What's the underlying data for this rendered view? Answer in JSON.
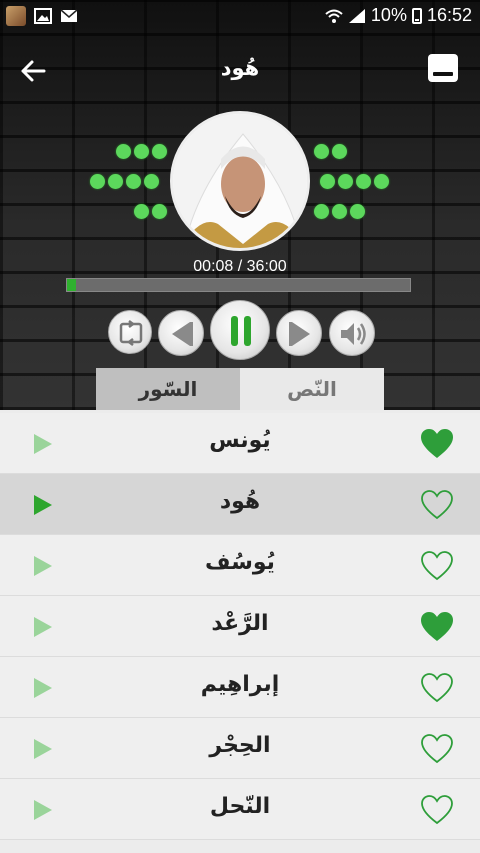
{
  "status_bar": {
    "battery": "10%",
    "time": "16:52",
    "icons": [
      "photo-notification-icon",
      "image-icon",
      "mail-icon",
      "wifi-icon",
      "signal-icon",
      "battery-icon"
    ]
  },
  "toolbar": {
    "title": "هُود",
    "back_icon": "back-arrow-icon",
    "minimize_icon": "minimize-icon"
  },
  "player": {
    "elapsed": "00:08",
    "total": "36:00",
    "time_label": "00:08 / 36:00",
    "progress_fraction": 0.004,
    "controls": [
      "repeat-icon",
      "previous-icon",
      "pause-icon",
      "next-icon",
      "volume-icon"
    ]
  },
  "tabs": {
    "text": "النّص",
    "surahs": "السّور",
    "active": "surahs"
  },
  "colors": {
    "accent_green": "#2fb12f",
    "dot_green": "#5cd85c",
    "heart_green": "#2e9e3a"
  },
  "surahs": [
    {
      "name": "يُونس",
      "favorite": true,
      "playing": false
    },
    {
      "name": "هُود",
      "favorite": false,
      "playing": true
    },
    {
      "name": "يُوسُف",
      "favorite": false,
      "playing": false
    },
    {
      "name": "الرَّعْد",
      "favorite": true,
      "playing": false
    },
    {
      "name": "إبراهِيم",
      "favorite": false,
      "playing": false
    },
    {
      "name": "الحِجْر",
      "favorite": false,
      "playing": false
    },
    {
      "name": "النّحل",
      "favorite": false,
      "playing": false
    }
  ]
}
